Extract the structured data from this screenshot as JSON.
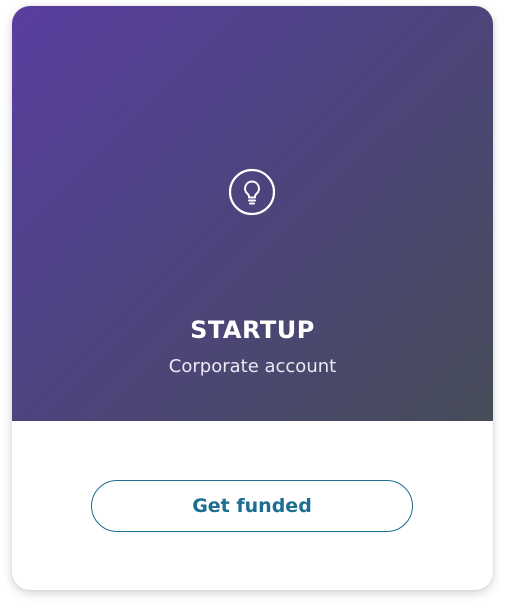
{
  "card": {
    "icon": "lightbulb-icon",
    "title": "STARTUP",
    "subtitle": "Corporate account",
    "cta_label": "Get funded"
  },
  "colors": {
    "gradient_start": "#5a3ea0",
    "gradient_end": "#464c58",
    "accent": "#1e6e91",
    "text_on_dark": "#ffffff"
  }
}
